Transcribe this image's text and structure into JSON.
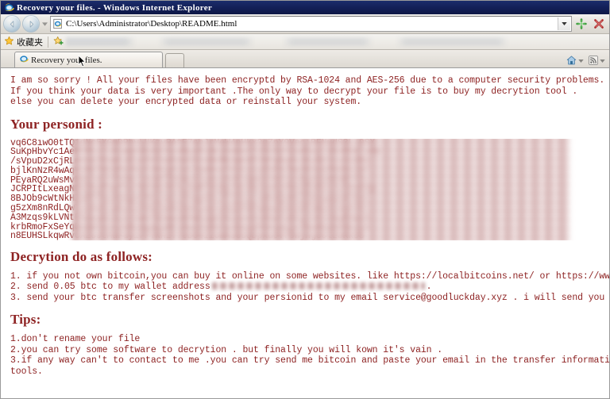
{
  "window": {
    "title": "Recovery your files. - Windows Internet Explorer",
    "ie_icon": "internet-explorer-icon"
  },
  "toolbar": {
    "back_label": "Back",
    "forward_label": "Forward",
    "address_value": "C:\\Users\\Administrator\\Desktop\\README.html",
    "address_placeholder": "",
    "address_dropdown_icon": "chevron-down-icon",
    "refresh_icon": "refresh-icon",
    "stop_icon": "stop-icon",
    "page_favicon": "html-document-icon"
  },
  "favorites_bar": {
    "favorites_label": "收藏夹",
    "favorites_icon": "star-icon",
    "add_favorite_icon": "add-favorite-icon"
  },
  "tabs": [
    {
      "label": "Recovery your files.",
      "favicon": "internet-explorer-icon",
      "active": true
    }
  ],
  "tabstrip_right": {
    "home_icon": "home-icon",
    "feeds_icon": "rss-feed-icon",
    "caret_icon": "chevron-down-icon"
  },
  "content": {
    "intro_lines": [
      "I am so sorry ! All your files have been encryptd by RSA-1024 and AES-256 due to a computer security problems.",
      "If you think your data is very important .The only way to decrypt your file is to buy my decrytion tool .",
      "else you can delete your encrypted data or reinstall your system."
    ],
    "personid_heading": "Your personid :",
    "personid_lines": [
      "vq6C8iwO0tTQ1dNc5XGmDPhvLUKzyRAfE7sbJrMeW4nHkx2gZpY9VaciBFNudS3L-9SX",
      "SuKpHbvYc1AeRfMtz7J0iWqkVQ9oChx4NgsPLBEyDmUdrT2nGXZFIa85wjl3OvRbK'w8W",
      "/sVpuD2xCjRLmYoQ7FaWtzE1c0hTAd5SnHIreBkMbUwKXfZ9PgNq4vJ6yGOlcs3iD5Q",
      "bjlKnNzR4wAqVcMeT9XdPpYbLF2hGg01sCJuWHov7EUtyiaZSk6rDmIB3xQfO85njdr",
      "PEyaRQ2uWsMvNbCiXjT7hGkrL0o9fZdD4pt1eAnzSUFJqmKcYB3lxV6gHIwO58R?+IL",
      "JCRPItLxeagNDkZmqY3wfSu70dV9jhCب6BoMTXGAprEnvW1s4KzFbOiQU52cJylRnO0p",
      "8BJOb9cWtNkHZmRfPxuS6AgVCMELvaIsYDqyG3j7FT21irodKXQn05lhBzwpUe4TEeC",
      "g5zXm8nRdLQwTcVAoFrpKv1SYHN7aUBIbmkjsexJGZCM3Pq6wyhDtE9f0W24lOuXY07",
      "A3Mzqs9kLVNtPhdyuECXJIrDaGfbSwenB8WoiQmYKZ1vc0xR6pTUO5j72HlFAgM4pcN",
      "krbRmoFxSeYqDvGWTn3ZJkBiUgaLQHPl0wCXV9N7y2OscdMIA1uEjtfKp86zhR5bJjX",
      "n8EUHSLkqwRvCXZoJtMaFdy1rPYNhzT7eB04IiGmAs63QDpxu9Vf5WjngcOl2bKk5S"
    ],
    "decryption_heading": "Decrytion do as follows:",
    "decryption_steps": [
      "1. if you not own bitcoin,you can buy it online on some websites. like https://localbitcoins.net/ or https://www.coinbase.com/ .",
      "2. send 0.05 btc to my wallet address",
      "3. send your btc transfer screenshots and your persionid to my email service@goodluckday.xyz . i will send you decrytion tool."
    ],
    "wallet_address_masked": "",
    "wallet_line_suffix": ".",
    "tips_heading": "Tips:",
    "tips": [
      "1.don't rename your file",
      "2.you can try some software to decrytion . but finally you will kown it's vain .",
      "3.if any way can't to contact to me .you can try send me bitcoin and paste your email in the transfer information. i will contact",
      "tools."
    ]
  },
  "colors": {
    "text_red": "#8e2323",
    "title_bar": "#14215a",
    "chrome": "#d6d3ce",
    "page_bg": "#ffffff"
  }
}
